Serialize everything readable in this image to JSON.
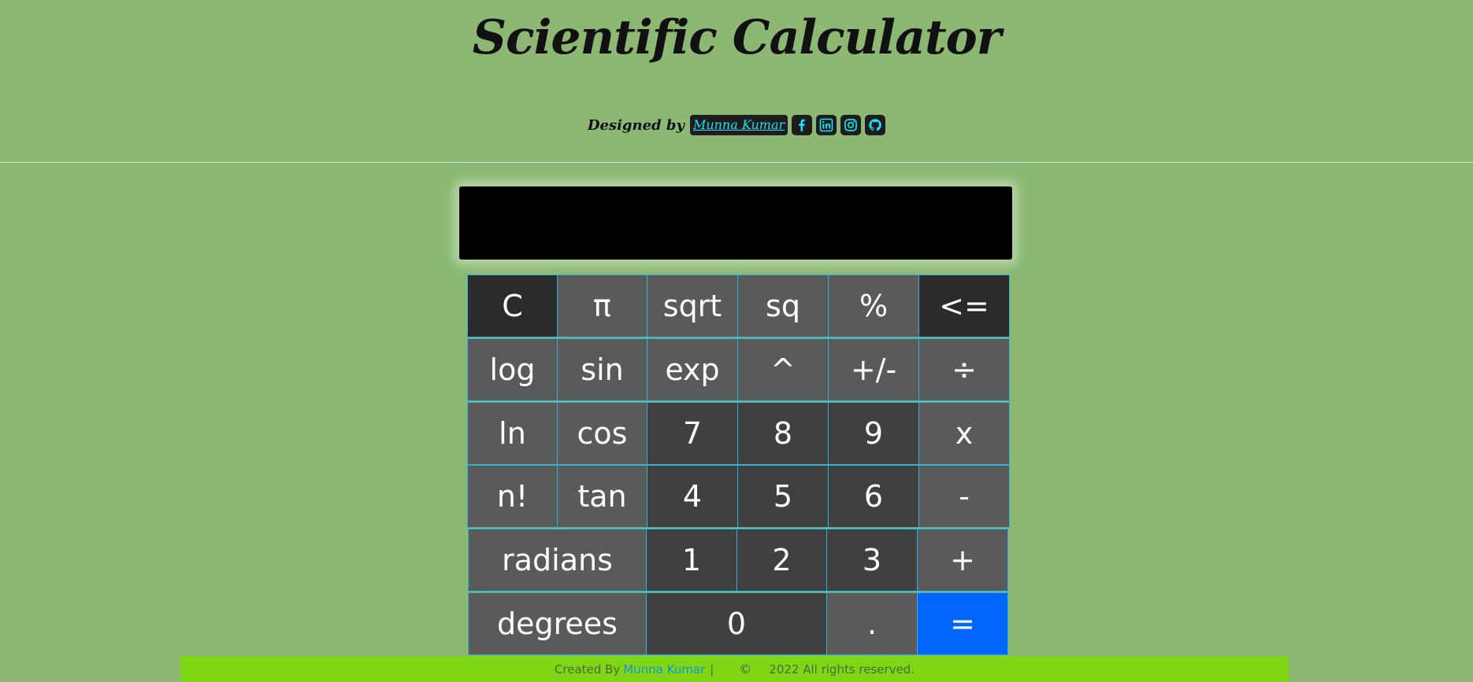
{
  "header": {
    "title": "Scientific Calculator",
    "designed_by": "Designed by",
    "author": "Munna Kumar",
    "social": [
      {
        "name": "facebook-icon",
        "glyph": "f"
      },
      {
        "name": "linkedin-icon",
        "glyph": "in"
      },
      {
        "name": "instagram-icon",
        "glyph": ""
      },
      {
        "name": "github-icon",
        "glyph": ""
      }
    ]
  },
  "display": {
    "value": ""
  },
  "keys": {
    "clear": "C",
    "pi": "π",
    "sqrt": "sqrt",
    "sq": "sq",
    "percent": "%",
    "backspace": "<=",
    "log": "log",
    "sin": "sin",
    "exp": "exp",
    "power": "^",
    "negate": "+/-",
    "divide": "÷",
    "ln": "ln",
    "cos": "cos",
    "seven": "7",
    "eight": "8",
    "nine": "9",
    "multiply": "x",
    "factorial": "n!",
    "tan": "tan",
    "four": "4",
    "five": "5",
    "six": "6",
    "minus": "-",
    "radians": "radians",
    "one": "1",
    "two": "2",
    "three": "3",
    "plus": "+",
    "degrees": "degrees",
    "zero": "0",
    "dot": ".",
    "equals": "="
  },
  "footer": {
    "created_by": "Created By",
    "author": "Munna Kumar",
    "separator": "|",
    "copyright_symbol": "©",
    "rights": "2022 All rights reserved."
  },
  "colors": {
    "background": "#8cb874",
    "accent_cyan": "#18e0f0",
    "equals_blue": "#0066ff",
    "footer_green": "#7ed614"
  }
}
